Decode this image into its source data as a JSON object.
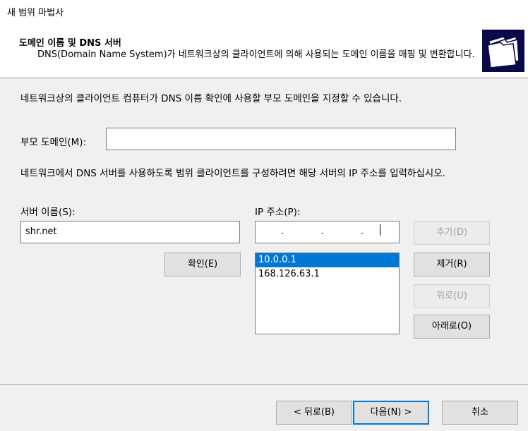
{
  "window": {
    "title": "새 범위 마법사"
  },
  "header": {
    "title": "도메인 이름 및 DNS 서버",
    "subtitle": "DNS(Domain Name System)가 네트워크상의 클라이언트에 의해 사용되는 도메인 이름을 매핑 및 변환합니다.",
    "icon": "folders-icon"
  },
  "main": {
    "description": "네트워크상의 클라이언트 컴퓨터가 DNS 이름 확인에 사용할 부모 도메인을 지정할 수 있습니다.",
    "parent_domain_label": "부모 도메인(M):",
    "parent_domain_value": "",
    "dns_instruction": "네트워크에서 DNS 서버를 사용하도록 범위 클라이언트를 구성하려면 해당 서버의 IP 주소를 입력하십시오.",
    "server_name_label": "서버 이름(S):",
    "server_name_value": "shr.net",
    "ip_label": "IP 주소(P):",
    "ip_placeholder": ".          .          .",
    "resolve_button": "확인(E)",
    "ip_list": [
      "10.0.0.1",
      "168.126.63.1"
    ],
    "selected_ip": "10.0.0.1"
  },
  "side_buttons": {
    "add": "추가(D)",
    "remove": "제거(R)",
    "up": "위로(U)",
    "down": "아래로(O)"
  },
  "footer": {
    "back": "< 뒤로(B)",
    "next": "다음(N) >",
    "cancel": "취소"
  },
  "colors": {
    "accent": "#0078d7",
    "icon_bg": "#0a0a4a"
  }
}
